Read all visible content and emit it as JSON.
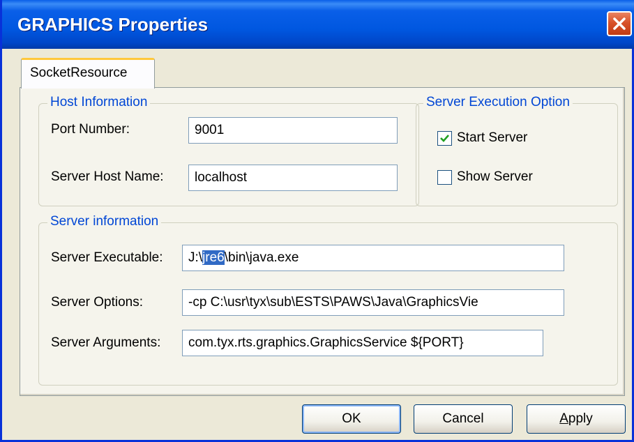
{
  "window": {
    "title": "GRAPHICS Properties"
  },
  "tabs": [
    {
      "label": "SocketResource"
    }
  ],
  "host_info": {
    "title": "Host Information",
    "port_label": "Port Number:",
    "port_value": "9001",
    "host_label": "Server Host Name:",
    "host_value": "localhost"
  },
  "exec_option": {
    "title": "Server Execution Option",
    "start_server": {
      "label": "Start Server",
      "checked": true
    },
    "show_server": {
      "label": "Show Server",
      "checked": false
    }
  },
  "server_info": {
    "title": "Server information",
    "exe_label": "Server Executable:",
    "exe_value_prefix": "J:\\",
    "exe_value_selected": "jre6",
    "exe_value_suffix": "\\bin\\java.exe",
    "options_label": "Server Options:",
    "options_value": "-cp C:\\usr\\tyx\\sub\\ESTS\\PAWS\\Java\\GraphicsVie",
    "args_label": "Server Arguments:",
    "args_value": "com.tyx.rts.graphics.GraphicsService ${PORT}"
  },
  "buttons": {
    "ok": "OK",
    "cancel": "Cancel",
    "apply_first": "A",
    "apply_rest": "pply"
  },
  "colors": {
    "titlebar": "#0a5fe8",
    "group_title": "#0046d5",
    "selection": "#316ac5",
    "close_button": "#d8522a",
    "tab_highlight": "#ffc83c"
  }
}
